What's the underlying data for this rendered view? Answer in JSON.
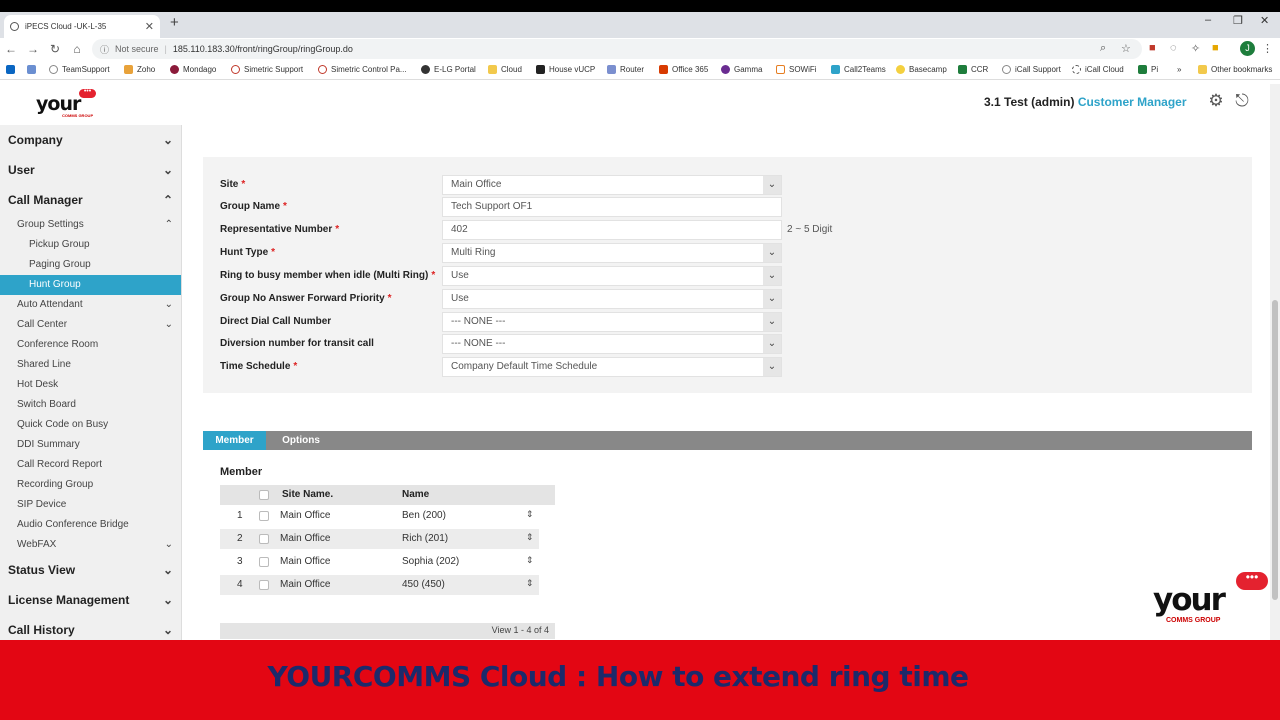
{
  "browser": {
    "tab_title": "iPECS Cloud -UK-L-35",
    "tab_close": "✕",
    "new_tab": "+",
    "window_controls": [
      "–",
      "❐",
      "✕"
    ],
    "security_label": "Not secure",
    "url": "185.110.183.30/front/ringGroup/ringGroup.do",
    "avatar_initial": "J",
    "bookmarks": [
      "TeamSupport",
      "Zoho",
      "Mondago",
      "Simetric Support",
      "Simetric Control Pa...",
      "E-LG Portal",
      "Cloud",
      "House vUCP",
      "Router",
      "Office 365",
      "Gamma",
      "SOWiFi",
      "Call2Teams",
      "Basecamp",
      "CCR",
      "iCall Support",
      "iCall Cloud",
      "Pi"
    ],
    "bookmarks_overflow": "»",
    "other_bookmarks": "Other bookmarks"
  },
  "header": {
    "logo": "your",
    "logo_sub": "COMMS GROUP",
    "logo_bubble": "•••",
    "user": "3.1 Test (admin)",
    "role": "Customer Manager"
  },
  "sidebar": {
    "company": "Company",
    "user": "User",
    "call_manager": "Call Manager",
    "group_settings": "Group Settings",
    "pickup_group": "Pickup Group",
    "paging_group": "Paging Group",
    "hunt_group": "Hunt Group",
    "auto_attendant": "Auto Attendant",
    "call_center": "Call Center",
    "conference_room": "Conference Room",
    "shared_line": "Shared Line",
    "hot_desk": "Hot Desk",
    "switch_board": "Switch Board",
    "quick_code": "Quick Code on Busy",
    "ddi_summary": "DDI Summary",
    "call_record_report": "Call Record Report",
    "recording_group": "Recording Group",
    "sip_device": "SIP Device",
    "audio_conference_bridge": "Audio Conference Bridge",
    "webfax": "WebFAX",
    "status_view": "Status View",
    "license_management": "License Management",
    "call_history": "Call History"
  },
  "form": {
    "site_label": "Site",
    "site_value": "Main Office",
    "group_name_label": "Group Name",
    "group_name_value": "Tech Support OF1",
    "rep_number_label": "Representative Number",
    "rep_number_value": "402",
    "rep_number_hint": "2 ~ 5 Digit",
    "hunt_type_label": "Hunt Type",
    "hunt_type_value": "Multi Ring",
    "ring_busy_label": "Ring to busy member when idle (Multi Ring)",
    "ring_busy_value": "Use",
    "no_answer_label": "Group No Answer Forward Priority",
    "no_answer_value": "Use",
    "direct_dial_label": "Direct Dial Call Number",
    "direct_dial_value": "--- NONE ---",
    "diversion_label": "Diversion number for transit call",
    "diversion_value": "--- NONE ---",
    "time_schedule_label": "Time Schedule",
    "time_schedule_value": "Company Default Time Schedule",
    "required_mark": "*",
    "dropdown_glyph": "⌄"
  },
  "members": {
    "tab_member": "Member",
    "tab_options": "Options",
    "title": "Member",
    "col_site": "Site Name.",
    "col_name": "Name",
    "rows": [
      {
        "index": "1",
        "site": "Main Office",
        "name": "Ben (200)"
      },
      {
        "index": "2",
        "site": "Main Office",
        "name": "Rich (201)"
      },
      {
        "index": "3",
        "site": "Main Office",
        "name": "Sophia (202)"
      },
      {
        "index": "4",
        "site": "Main Office",
        "name": "450 (450)"
      }
    ],
    "pager": "View 1 - 4 of 4"
  },
  "watermark": {
    "text": "your",
    "sub": "COMMS GROUP",
    "bubble": "•••"
  },
  "banner": {
    "text": "YOURCOMMS  Cloud : How to extend ring time"
  }
}
